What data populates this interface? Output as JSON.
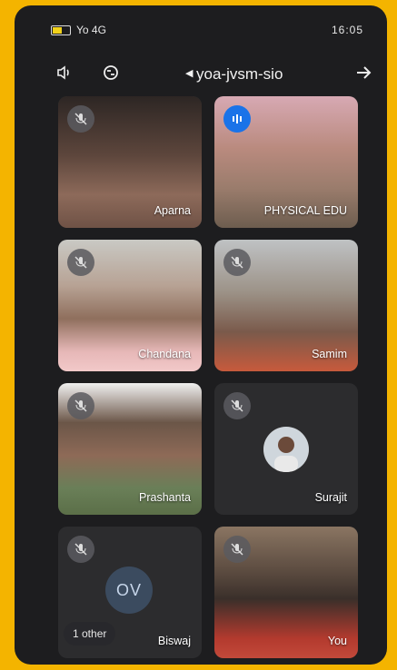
{
  "status": {
    "time": "16:05",
    "network": "Yo 4G"
  },
  "topbar": {
    "title": "yoa-jvsm-sio"
  },
  "tiles": [
    {
      "name": "Aparna",
      "muted": true
    },
    {
      "name": "PHYSICAL EDU",
      "speaking": true
    },
    {
      "name": "Chandana",
      "muted": true
    },
    {
      "name": "Samim",
      "muted": true
    },
    {
      "name": "Prashanta",
      "muted": true
    },
    {
      "name": "Surajit",
      "muted": true
    },
    {
      "name": "Biswaj",
      "initials": "OV",
      "others": "1 other",
      "muted": true
    },
    {
      "name": "You",
      "muted": true
    }
  ],
  "colors": {
    "frame": "#f4b400",
    "background": "#1d1d1f",
    "tile": "#3a3a3c",
    "speaking": "#1a73e8"
  }
}
